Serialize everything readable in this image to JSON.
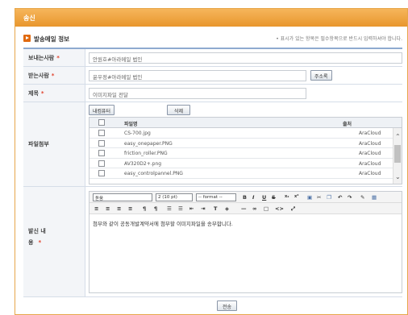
{
  "window": {
    "title": "송신"
  },
  "section": {
    "title": "발송메일 정보",
    "required_note": "• 표시가 있는 항목은 필수항목으로 반드시 입력하셔야 합니다."
  },
  "form": {
    "sender": {
      "label": "보내는사람",
      "value": "안원호#아라메일 법인"
    },
    "recipient": {
      "label": "받는사람",
      "value": "윤우정#아라메일 법인",
      "address_book_button": "주소록"
    },
    "subject": {
      "label": "제목",
      "value": "이미지파일 전달"
    },
    "attachment": {
      "label": "파일첨부",
      "internal_pc_button": "내컴퓨터",
      "delete_button": "삭제",
      "columns": [
        "파일명",
        "출처"
      ],
      "files": [
        {
          "name": "CS-700.jpg",
          "source": "AraCloud"
        },
        {
          "name": "easy_onepaper.PNG",
          "source": "AraCloud"
        },
        {
          "name": "friction_roller.PNG",
          "source": "AraCloud"
        },
        {
          "name": "AV320D2+.png",
          "source": "AraCloud"
        },
        {
          "name": "easy_controlpannel.PNG",
          "source": "AraCloud"
        }
      ]
    },
    "body": {
      "label_line1": "발신 내",
      "label_line2": "용",
      "font_family": "돋움",
      "font_size": "2 (10 pt)",
      "format": "-- format --",
      "content": "첨부와 같이 공동개발계약서에 첨부할 이미지파일을 송부합니다."
    }
  },
  "footer": {
    "send_button": "전송"
  },
  "colors": {
    "title_bar": "#e8962c",
    "required_star": "#e0402a",
    "section_icon": "#e06a10",
    "form_border": "#8eaad0"
  }
}
